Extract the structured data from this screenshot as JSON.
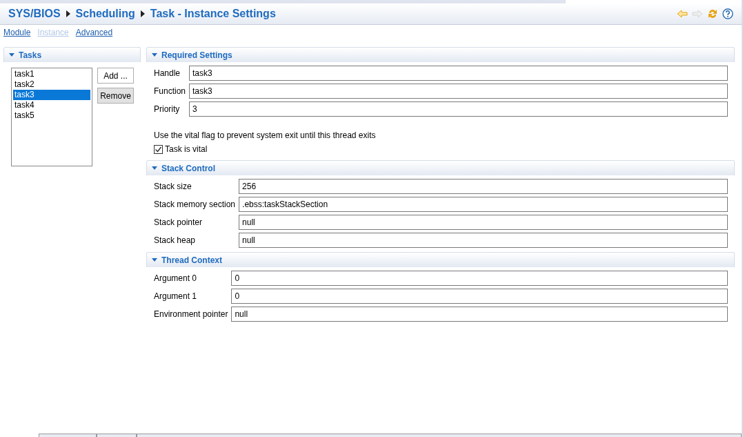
{
  "breadcrumb": [
    {
      "label": "SYS/BIOS"
    },
    {
      "label": "Scheduling"
    },
    {
      "label": "Task - Instance Settings"
    }
  ],
  "header_actions": [
    {
      "kind": "back",
      "disabled": false
    },
    {
      "kind": "forward",
      "disabled": true
    },
    {
      "kind": "sync",
      "disabled": false
    },
    {
      "kind": "help",
      "disabled": false
    }
  ],
  "nav_links": [
    {
      "label": "Module",
      "disabled": false
    },
    {
      "label": "Instance",
      "disabled": true
    },
    {
      "label": "Advanced",
      "disabled": false
    }
  ],
  "tasks_panel": {
    "title": "Tasks",
    "items": [
      {
        "label": "task1",
        "selected": false
      },
      {
        "label": "task2",
        "selected": false
      },
      {
        "label": "task3",
        "selected": true
      },
      {
        "label": "task4",
        "selected": false
      },
      {
        "label": "task5",
        "selected": false
      }
    ],
    "buttons": [
      {
        "label": "Add ...",
        "pressed": false
      },
      {
        "label": "Remove",
        "pressed": true
      }
    ]
  },
  "sections": [
    {
      "title": "Required Settings",
      "fields": [
        {
          "label": "Handle",
          "value": "task3"
        },
        {
          "label": "Function",
          "value": "task3"
        },
        {
          "label": "Priority",
          "value": "3"
        }
      ],
      "note": "Use the vital flag to prevent system exit until this thread exits",
      "checkbox": {
        "label": "Task is vital",
        "checked": true
      }
    },
    {
      "title": "Stack Control",
      "fields": [
        {
          "label": "Stack size",
          "value": "256"
        },
        {
          "label": "Stack memory section",
          "value": ".ebss:taskStackSection"
        },
        {
          "label": "Stack pointer",
          "value": "null"
        },
        {
          "label": "Stack heap",
          "value": "null"
        }
      ]
    },
    {
      "title": "Thread Context",
      "fields": [
        {
          "label": "Argument 0",
          "value": "0"
        },
        {
          "label": "Argument 1",
          "value": "0"
        },
        {
          "label": "Environment pointer",
          "value": "null"
        }
      ]
    }
  ]
}
